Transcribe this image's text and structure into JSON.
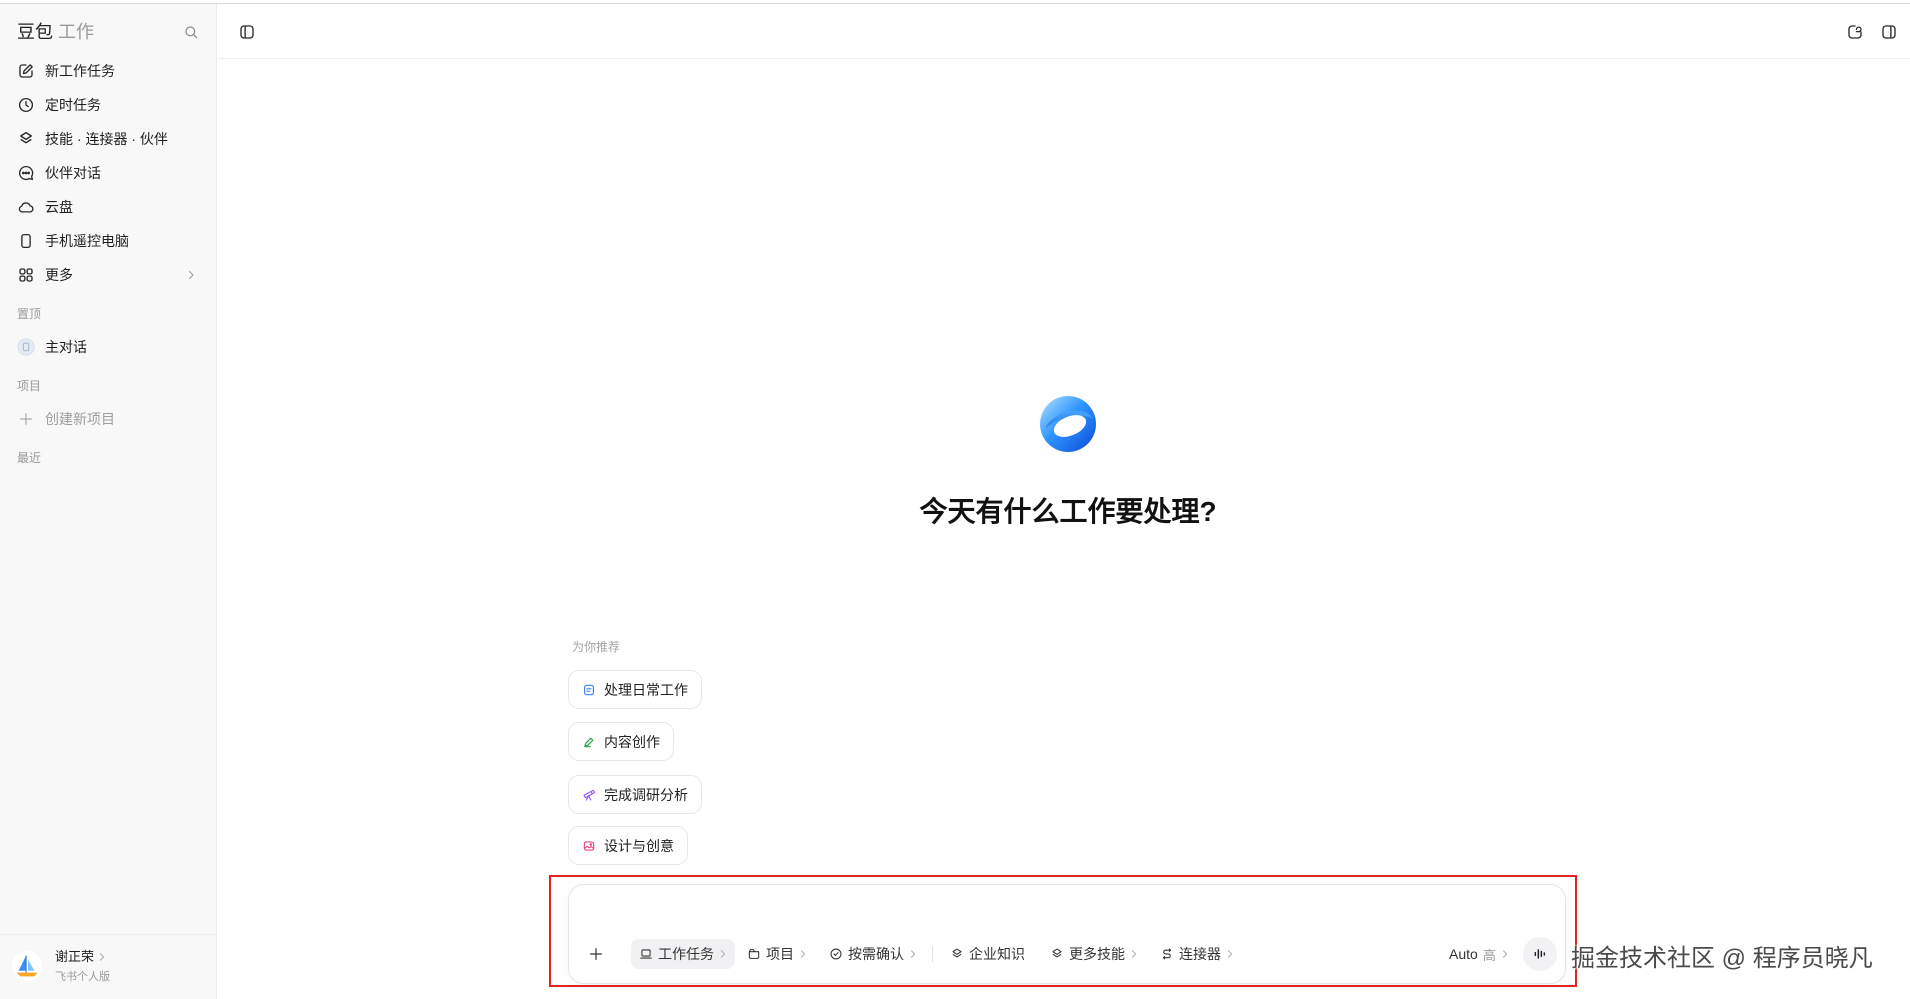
{
  "app": {
    "brand": "豆包",
    "brand_suffix": "工作"
  },
  "sidebar": {
    "nav": [
      {
        "label": "新工作任务",
        "icon": "edit-icon"
      },
      {
        "label": "定时任务",
        "icon": "clock-icon"
      },
      {
        "label": "技能 · 连接器 · 伙伴",
        "icon": "layers-icon"
      },
      {
        "label": "伙伴对话",
        "icon": "chat-bubble-icon"
      },
      {
        "label": "云盘",
        "icon": "cloud-icon"
      },
      {
        "label": "手机遥控电脑",
        "icon": "phone-icon"
      },
      {
        "label": "更多",
        "icon": "grid-icon"
      }
    ],
    "pinned": {
      "heading": "置顶",
      "items": [
        {
          "label": "主对话",
          "icon": "chat-avatar-icon"
        }
      ]
    },
    "projects": {
      "heading": "项目",
      "new_label": "创建新项目"
    },
    "recent": {
      "heading": "最近"
    },
    "user": {
      "name": "谢正荣",
      "plan": "飞书个人版"
    }
  },
  "main": {
    "heading": "今天有什么工作要处理?",
    "recommend": {
      "heading": "为你推荐",
      "items": [
        {
          "label": "处理日常工作",
          "icon": "document-icon",
          "color": "#3d7ef7"
        },
        {
          "label": "内容创作",
          "icon": "pen-icon",
          "color": "#27a246"
        },
        {
          "label": "完成调研分析",
          "icon": "telescope-icon",
          "color": "#9b59f0"
        },
        {
          "label": "设计与创意",
          "icon": "image-icon",
          "color": "#e5487f"
        }
      ]
    },
    "composer": {
      "tools": [
        {
          "label": "工作任务",
          "icon": "laptop-icon",
          "active": true,
          "has_menu": true
        },
        {
          "label": "项目",
          "icon": "folder-icon",
          "active": false,
          "has_menu": true
        },
        {
          "label": "按需确认",
          "icon": "check-circle-icon",
          "active": false,
          "has_menu": true
        },
        {
          "label": "企业知识",
          "icon": "layers-icon",
          "active": false,
          "has_menu": false
        },
        {
          "label": "更多技能",
          "icon": "layers-icon",
          "active": false,
          "has_menu": true
        },
        {
          "label": "连接器",
          "icon": "connector-icon",
          "active": false,
          "has_menu": true
        }
      ],
      "model": {
        "name": "Auto",
        "level": "高"
      }
    }
  },
  "overlay": {
    "annotation_color": "#e02424",
    "watermark": "掘金技术社区 @ 程序员晓凡"
  },
  "colors": {
    "sidebar_bg": "#f8f8f9",
    "text": "#1f1f1f",
    "muted": "#9a9a9a",
    "logo_blue": "#1e88ff"
  }
}
